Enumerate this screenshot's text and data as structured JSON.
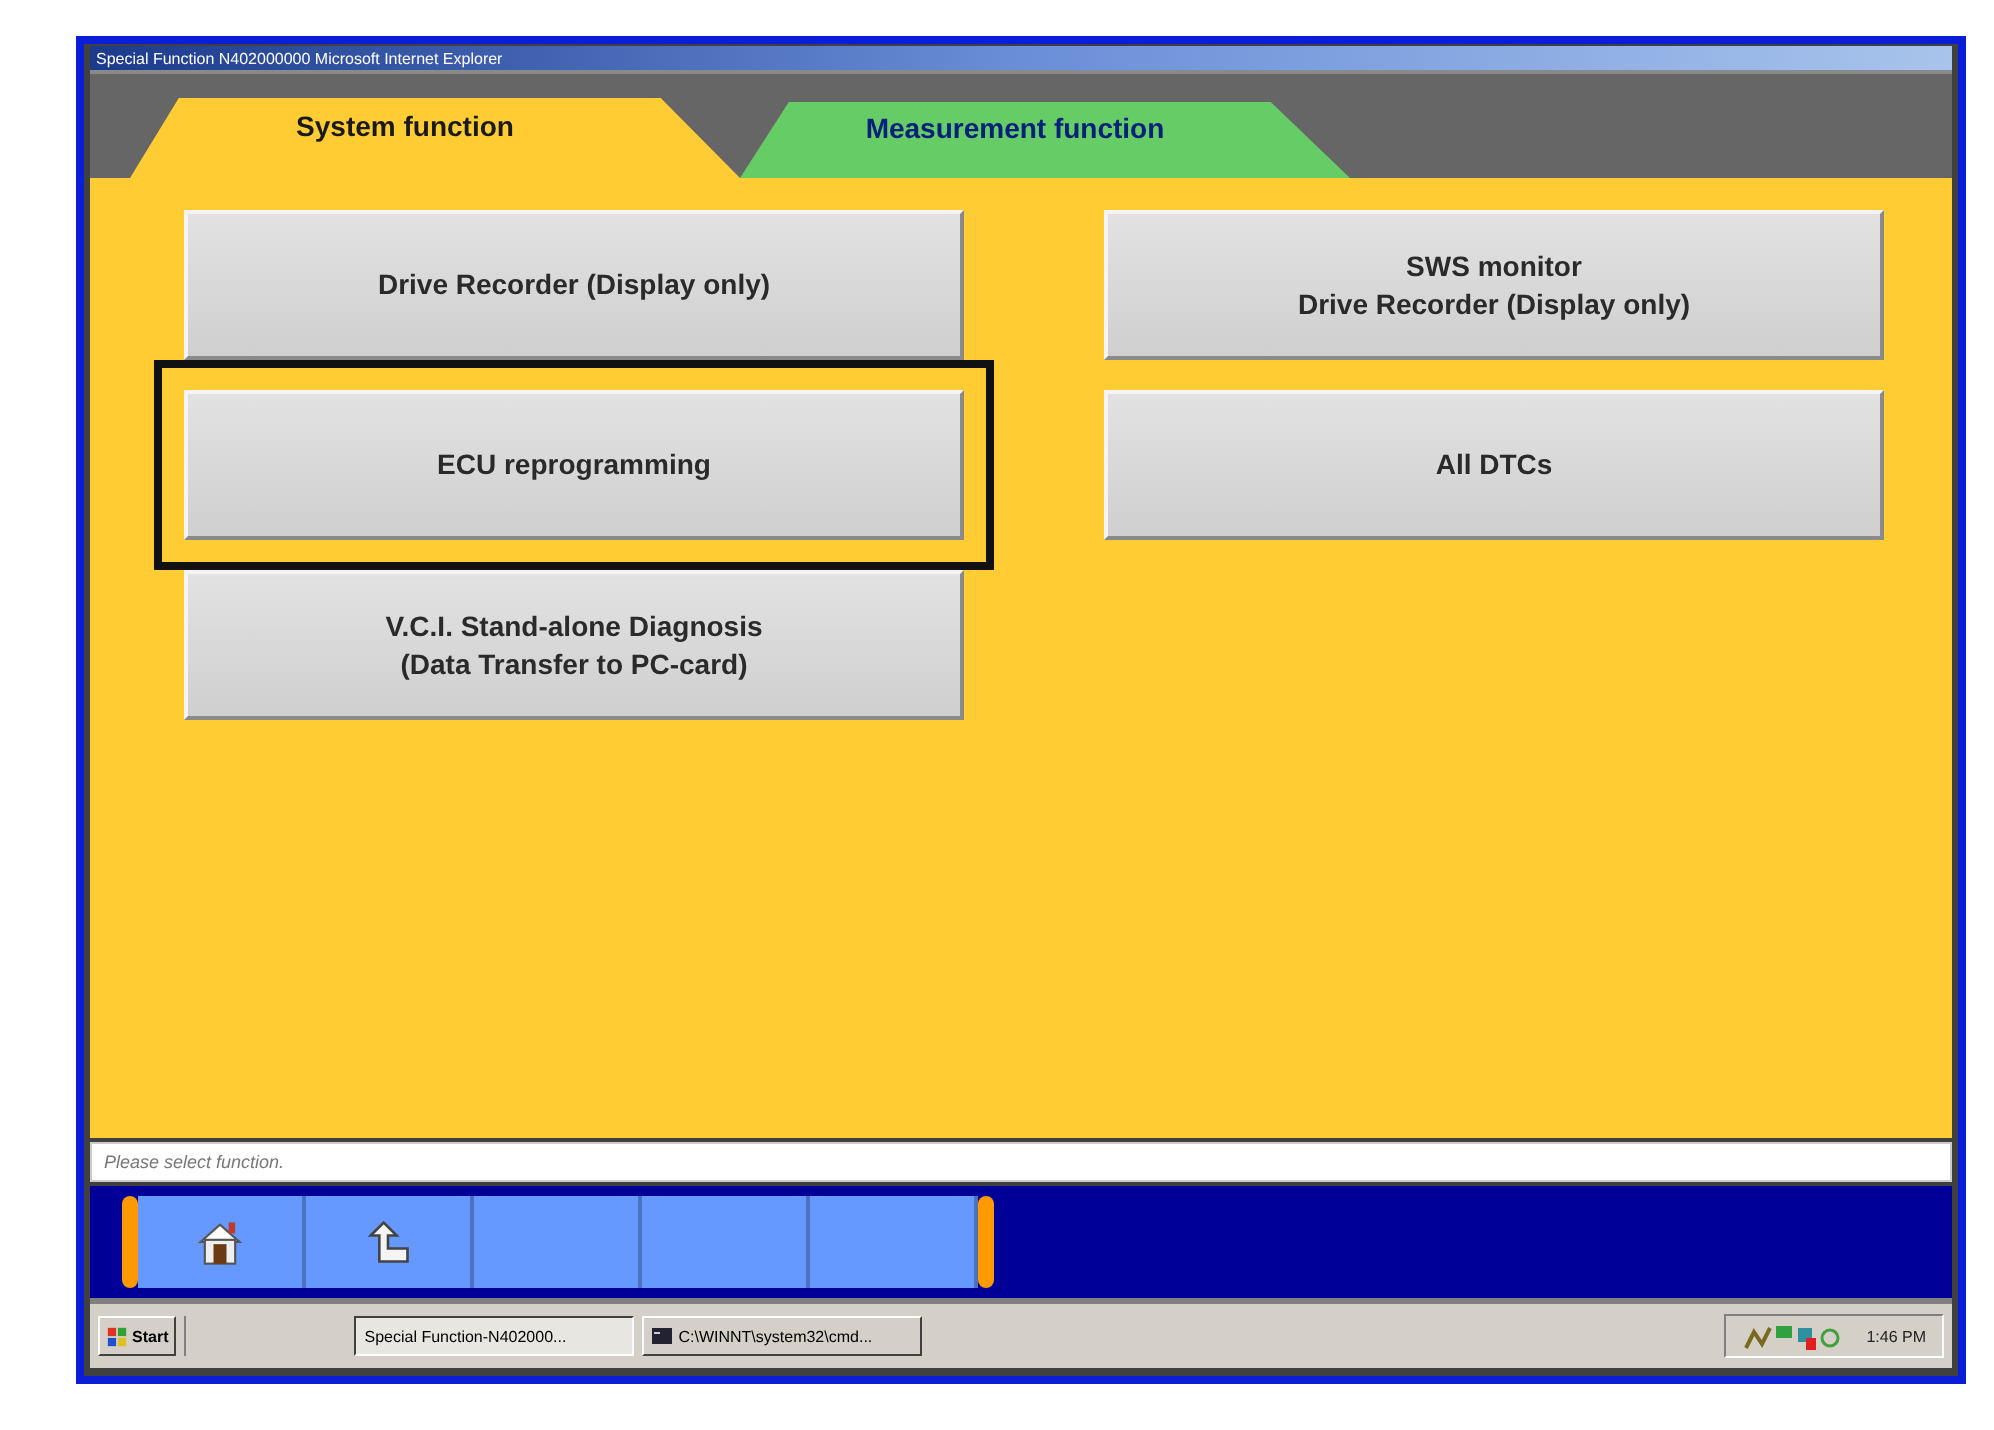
{
  "window": {
    "title": "Special Function N402000000  Microsoft Internet Explorer"
  },
  "tabs": [
    {
      "label": "System function",
      "selected": true,
      "color": "#ffcc33"
    },
    {
      "label": "Measurement function",
      "selected": false,
      "color": "#66cc66"
    }
  ],
  "left_column": [
    {
      "label": "Drive Recorder (Display only)",
      "highlighted": false
    },
    {
      "label": "ECU reprogramming",
      "highlighted": true
    },
    {
      "label": "V.C.I. Stand-alone Diagnosis\n(Data Transfer to PC-card)",
      "highlighted": false
    }
  ],
  "right_column": [
    {
      "label": "SWS monitor\nDrive Recorder (Display only)",
      "highlighted": false
    },
    {
      "label": "All DTCs",
      "highlighted": false
    }
  ],
  "message": "Please select function.",
  "toolbar": {
    "buttons": [
      {
        "kind": "home"
      },
      {
        "kind": "back"
      },
      {
        "kind": "blank"
      },
      {
        "kind": "blank"
      },
      {
        "kind": "blank"
      }
    ]
  },
  "taskbar": {
    "start": "Start",
    "tasks": [
      {
        "label": "Special Function-N402000...",
        "selected": true,
        "kind": "browser"
      },
      {
        "label": "C:\\WINNT\\system32\\cmd...",
        "selected": false,
        "kind": "console"
      }
    ],
    "clock": "1:46 PM"
  }
}
